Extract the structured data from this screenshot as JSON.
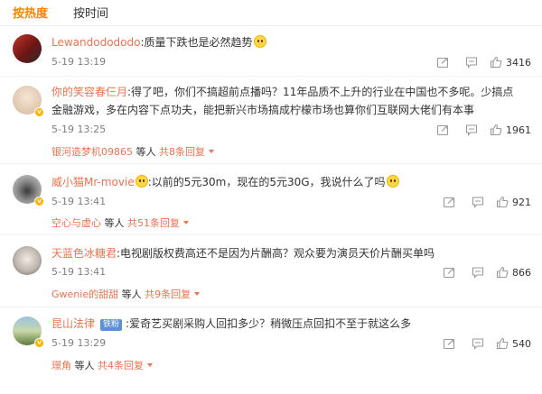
{
  "tabs": [
    {
      "label": "按热度",
      "active": true
    },
    {
      "label": "按时间",
      "active": false
    }
  ],
  "comments": [
    {
      "user": "Lewandodododo",
      "text": ":质量下跌也是必然趋势",
      "time": "5-19 13:19",
      "likes": "3416",
      "has_emoji": true
    },
    {
      "user": "你的笑容春仨月",
      "text": ":得了吧，你们不搞超前点播吗？11年品质不上升的行业在中国也不多呢。少搞点金融游戏，多在内容下点功夫，能把新兴市场搞成柠檬市场也算你们互联网大佬们有本事",
      "time": "5-19 13:25",
      "likes": "1961",
      "reply_user": "银河造梦机09865",
      "reply_mid": " 等人 ",
      "reply_count": "共8条回复"
    },
    {
      "user": "威小猫Mr-movie",
      "text": ":以前的5元30m，现在的5元30G，我说什么了吗",
      "time": "5-19 13:41",
      "likes": "921",
      "reply_user": "空心与虚心",
      "reply_mid": " 等人 ",
      "reply_count": "共51条回复"
    },
    {
      "user": "天蓝色冰糖君",
      "text": ":电视剧版权费高还不是因为片酬高？观众要为演员天价片酬买单吗",
      "time": "5-19 13:41",
      "likes": "866",
      "reply_user": "Gwenie的甜甜",
      "reply_mid": " 等人 ",
      "reply_count": "共9条回复"
    },
    {
      "user": "昆山法律",
      "tag": "铁粉",
      "text": ":爱奇艺买剧采购人回扣多少？稍微压点回扣不至于就这么多",
      "time": "5-19 13:29",
      "likes": "540",
      "reply_user": "璟角",
      "reply_mid": " 等人 ",
      "reply_count": "共4条回复"
    }
  ],
  "colors": {
    "accent": "#ff8200",
    "username": "#eb7350",
    "meta": "#808080",
    "divider": "#f2f2f2"
  },
  "icons": [
    "share-icon",
    "comment-icon",
    "like-icon"
  ]
}
